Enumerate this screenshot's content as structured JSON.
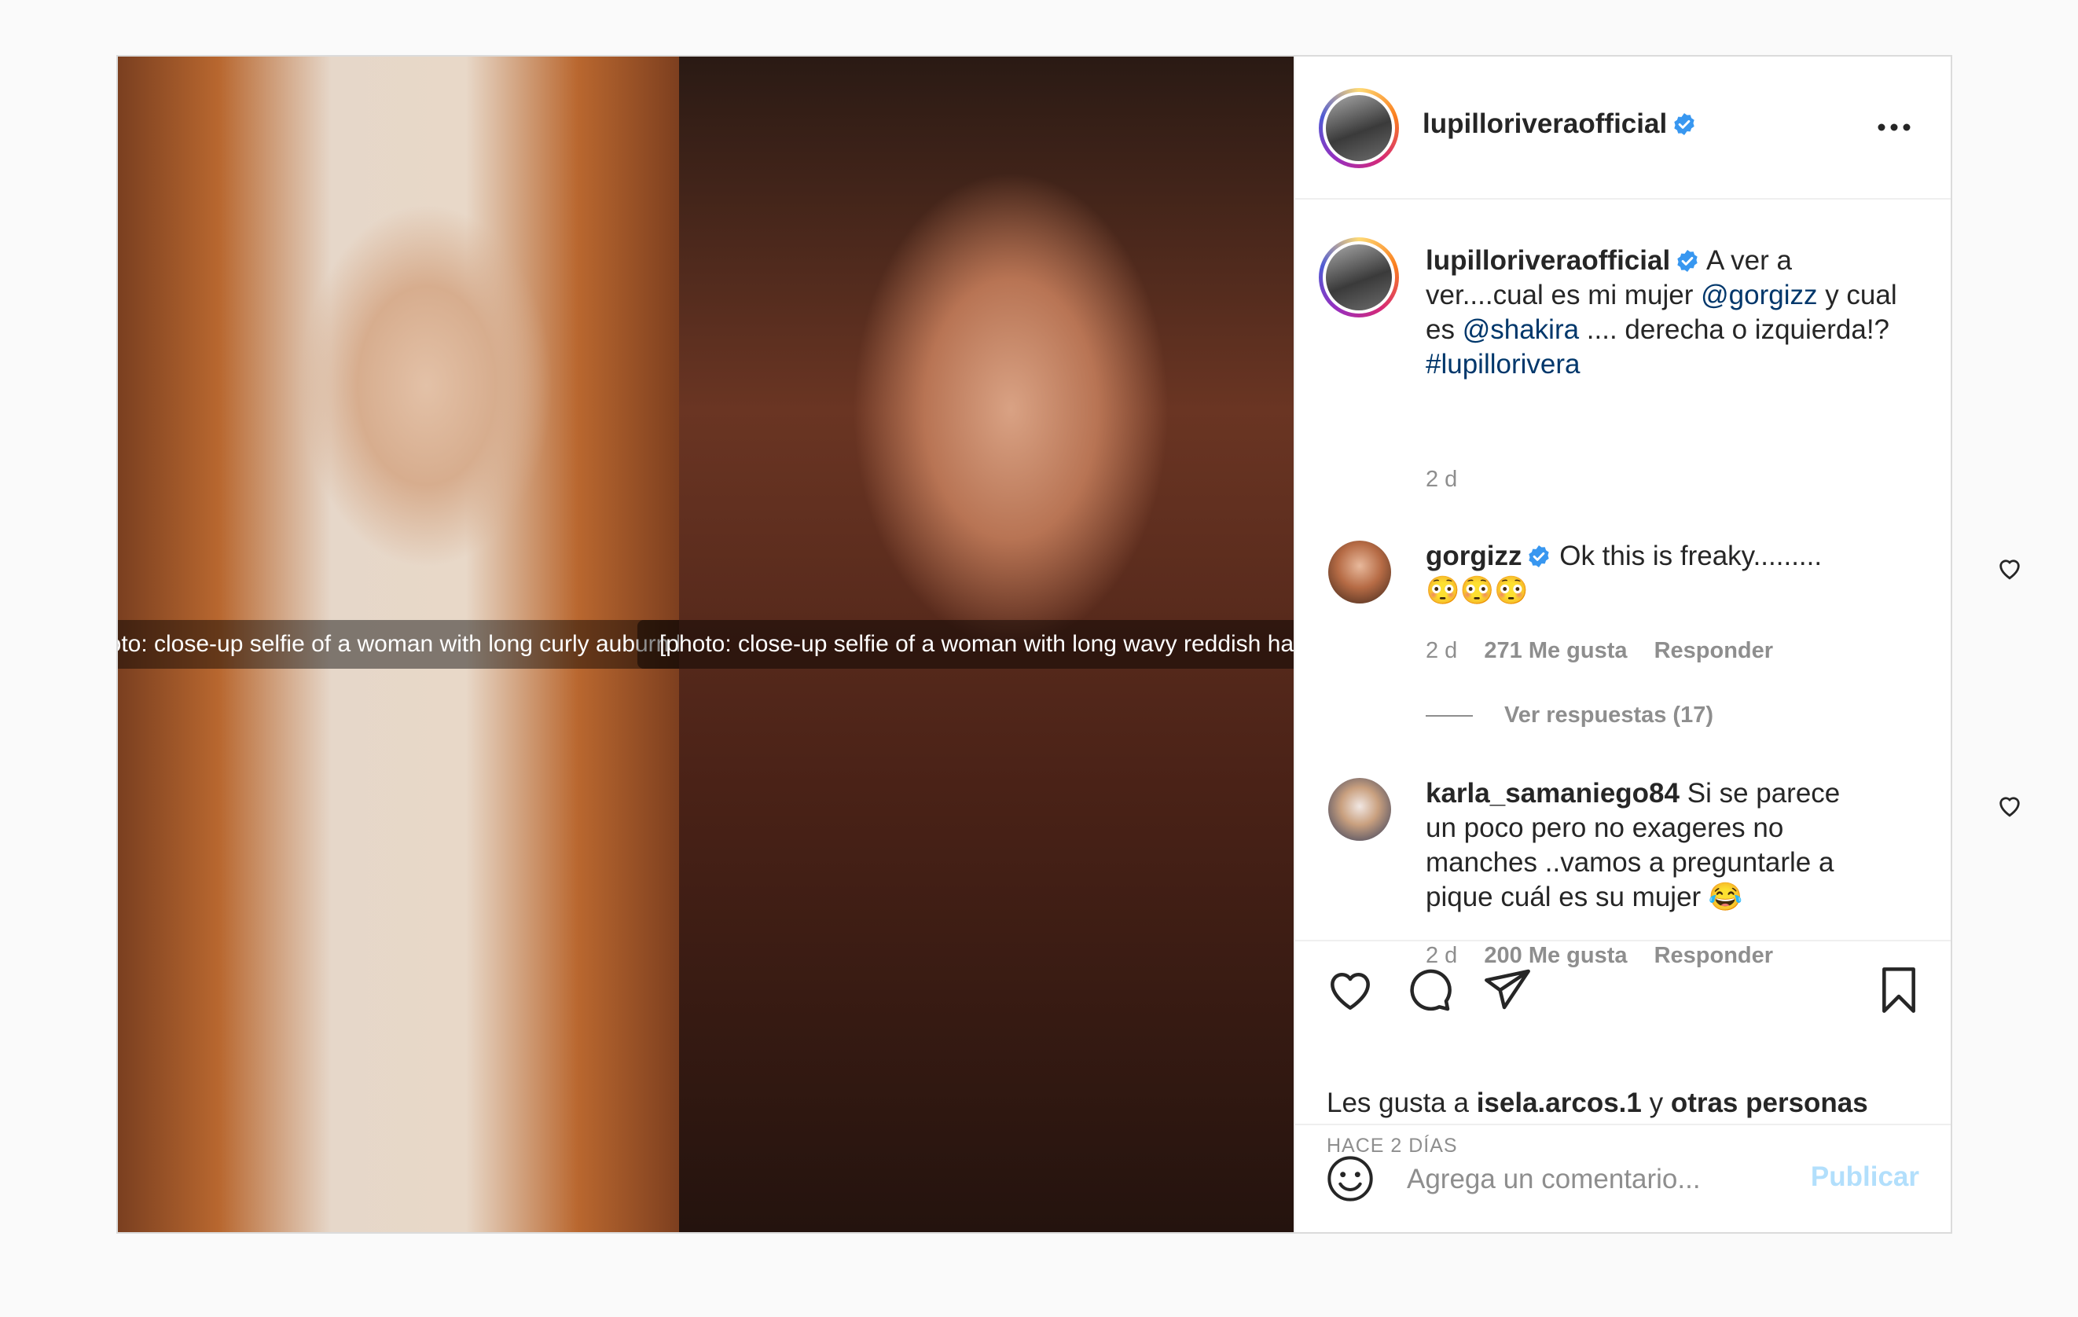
{
  "post": {
    "username": "lupilloriveraofficial",
    "more_icon": "more-dots-icon",
    "verified_icon": "verified-badge-icon"
  },
  "media": {
    "left_image": "[photo: close-up selfie of a woman with long curly auburn hair]",
    "right_image": "[photo: close-up selfie of a woman with long wavy reddish hair]"
  },
  "caption": {
    "username": "lupilloriveraofficial",
    "text_1": "A ver a ver....cual es mi mujer ",
    "mention_1": "@gorgizz",
    "text_2": " y cual es ",
    "mention_2": "@shakira",
    "text_3": " .... derecha o izquierda!? ",
    "hashtag": "#lupillorivera",
    "time": "2 d"
  },
  "comments": [
    {
      "username": "gorgizz",
      "verified": true,
      "text": "Ok this is freaky.........\n😳😳😳",
      "time": "2 d",
      "likes": "271 Me gusta",
      "reply": "Responder",
      "view_replies": "Ver respuestas (17)"
    },
    {
      "username": "karla_samaniego84",
      "verified": false,
      "text": "Si se parece un poco pero no exageres no manches ..vamos a preguntarle a pique cuál es su mujer 😂",
      "time": "2 d",
      "likes": "200 Me gusta",
      "reply": "Responder"
    }
  ],
  "actions": {
    "icons": [
      "heart-icon",
      "comment-icon",
      "share-icon",
      "bookmark-icon"
    ],
    "likes_prefix": "Les gusta a ",
    "likes_user": "isela.arcos.1",
    "likes_middle": " y ",
    "likes_others": "otras personas",
    "time_ago": "HACE 2 DÍAS"
  },
  "comment_box": {
    "emoji_icon": "emoji-icon",
    "placeholder": "Agrega un comentario...",
    "publish": "Publicar"
  },
  "colors": {
    "link": "#00376b",
    "verified": "#3897f0",
    "publish_disabled": "#b2dffc",
    "secondary_text": "#8e8e8e"
  }
}
